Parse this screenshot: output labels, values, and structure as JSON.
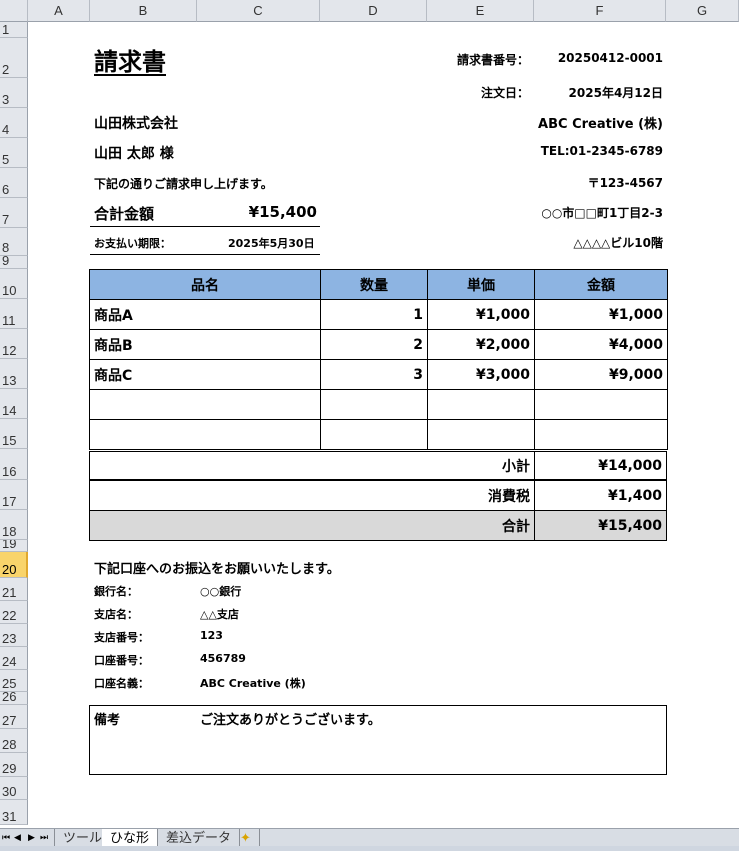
{
  "columns": [
    "A",
    "B",
    "C",
    "D",
    "E",
    "F",
    "G"
  ],
  "rows": [
    "1",
    "2",
    "3",
    "4",
    "5",
    "6",
    "7",
    "8",
    "9",
    "10",
    "11",
    "12",
    "13",
    "14",
    "15",
    "16",
    "17",
    "18",
    "19",
    "20",
    "21",
    "22",
    "23",
    "24",
    "25",
    "26",
    "27",
    "28",
    "29",
    "30",
    "31"
  ],
  "selected_row": "20",
  "invoice": {
    "title": "請求書",
    "number_label": "請求書番号：",
    "number_value": "20250412-0001",
    "order_date_label": "注文日：",
    "order_date_value": "2025年4月12日",
    "client_company": "山田株式会社",
    "client_name": "山田 太郎 様",
    "intro": "下記の通りご請求申し上げます。",
    "total_label": "合計金額",
    "total_value": "¥15,400",
    "due_label": "お支払い期限：",
    "due_value": "2025年5月30日",
    "issuer": {
      "company": "ABC Creative (株)",
      "tel": "TEL:01-2345-6789",
      "postal": "〒123-4567",
      "address1": "○○市□□町1丁目2-3",
      "address2": "△△△△ビル10階"
    }
  },
  "table": {
    "headers": [
      "品名",
      "数量",
      "単価",
      "金額"
    ],
    "header_color": "#8DB4E2",
    "rows": [
      {
        "name": "商品A",
        "qty": "1",
        "unit": "¥1,000",
        "amount": "¥1,000"
      },
      {
        "name": "商品B",
        "qty": "2",
        "unit": "¥2,000",
        "amount": "¥4,000"
      },
      {
        "name": "商品C",
        "qty": "3",
        "unit": "¥3,000",
        "amount": "¥9,000"
      },
      {
        "name": "",
        "qty": "",
        "unit": "",
        "amount": ""
      },
      {
        "name": "",
        "qty": "",
        "unit": "",
        "amount": ""
      }
    ],
    "subtotal_label": "小計",
    "subtotal_value": "¥14,000",
    "tax_label": "消費税",
    "tax_value": "¥1,400",
    "grand_label": "合計",
    "grand_value": "¥15,400",
    "grand_color": "#D9D9D9"
  },
  "bank": {
    "intro": "下記口座へのお振込をお願いいたします。",
    "items": [
      {
        "label": "銀行名：",
        "value": "○○銀行"
      },
      {
        "label": "支店名：",
        "value": "△△支店"
      },
      {
        "label": "支店番号：",
        "value": "123"
      },
      {
        "label": "口座番号：",
        "value": "456789"
      },
      {
        "label": "口座名義：",
        "value": "ABC Creative (株)"
      }
    ]
  },
  "notes": {
    "label": "備考",
    "value": "ご注文ありがとうございます。"
  },
  "sheet_tabs": [
    "ツール",
    "ひな形",
    "差込データ"
  ],
  "active_tab": "ひな形"
}
